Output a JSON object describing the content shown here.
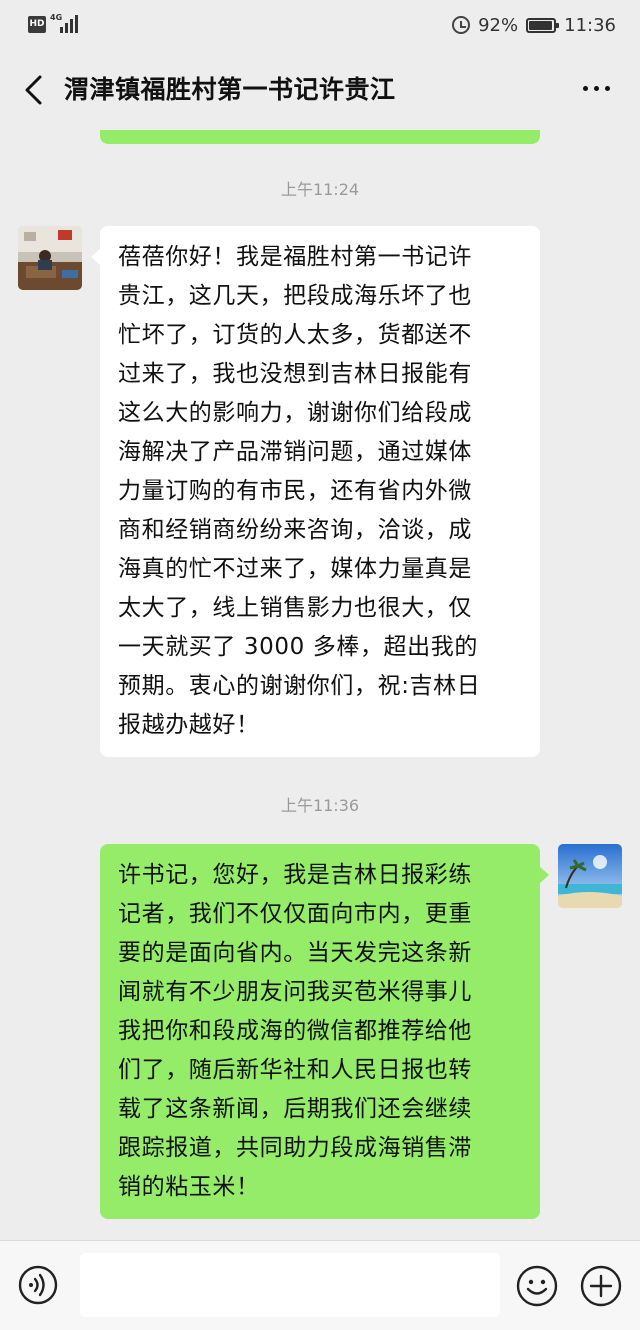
{
  "status_bar": {
    "hd": "HD",
    "network": "4G",
    "battery_percent": "92%",
    "time": "11:36"
  },
  "header": {
    "title": "渭津镇福胜村第一书记许贵江"
  },
  "messages": [
    {
      "time": "上午11:24",
      "side": "left",
      "text": "蓓蓓你好！我是福胜村第一书记许\n贵江，这几天，把段成海乐坏了也\n忙坏了，订货的人太多，货都送不\n过来了，我也没想到吉林日报能有\n这么大的影响力，谢谢你们给段成\n海解决了产品滞销问题，通过媒体\n力量订购的有市民，还有省内外微\n商和经销商纷纷来咨询，洽谈，成\n海真的忙不过来了，媒体力量真是\n太大了，线上销售影力也很大，仅\n一天就买了 3000 多棒，超出我的\n预期。衷心的谢谢你们，祝:吉林日\n报越办越好！"
    },
    {
      "time": "上午11:36",
      "side": "right",
      "text": "许书记，您好，我是吉林日报彩练\n记者，我们不仅仅面向市内，更重\n要的是面向省内。当天发完这条新\n闻就有不少朋友问我买苞米得事儿\n我把你和段成海的微信都推荐给他\n们了，随后新华社和人民日报也转\n载了这条新闻，后期我们还会继续\n跟踪报道，共同助力段成海销售滞\n销的粘玉米！"
    }
  ],
  "colors": {
    "background": "#ededed",
    "my_bubble": "#95ec69",
    "their_bubble": "#ffffff",
    "timestamp": "#9a9a9a"
  },
  "icons": {
    "back": "chevron-left-icon",
    "more": "more-dots-icon",
    "voice": "voice-icon",
    "emoji": "emoji-icon",
    "plus": "plus-icon"
  }
}
